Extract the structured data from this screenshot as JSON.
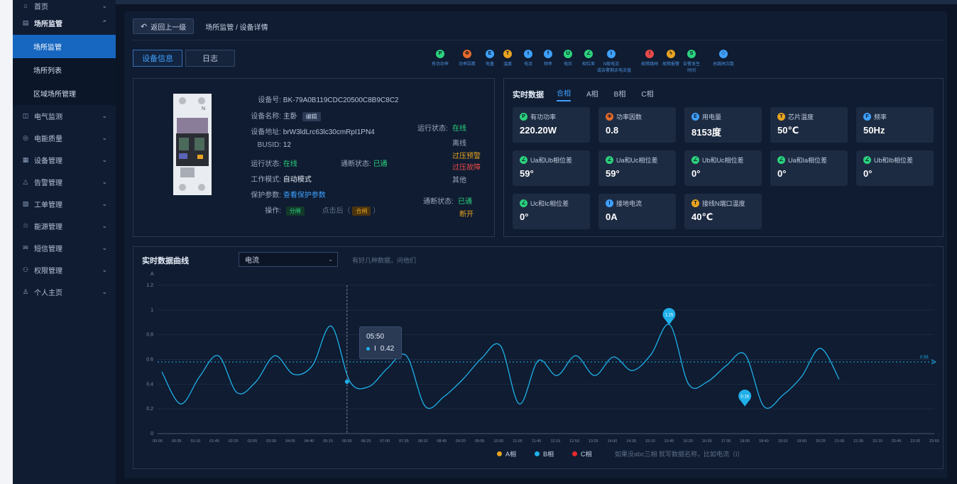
{
  "sidebar": {
    "items": [
      {
        "label": "首页",
        "icon": "home-icon",
        "glyph": "⌂"
      },
      {
        "label": "场所监管",
        "icon": "building-icon",
        "glyph": "▤",
        "expanded": true,
        "children": [
          "场所监管",
          "场所列表",
          "区域场所管理"
        ]
      },
      {
        "label": "电气监测",
        "icon": "monitor-icon",
        "glyph": "◫"
      },
      {
        "label": "电能质量",
        "icon": "quality-icon",
        "glyph": "◎"
      },
      {
        "label": "设备管理",
        "icon": "device-icon",
        "glyph": "▦"
      },
      {
        "label": "告警管理",
        "icon": "alarm-icon",
        "glyph": "△"
      },
      {
        "label": "工单管理",
        "icon": "ticket-icon",
        "glyph": "▧"
      },
      {
        "label": "能源管理",
        "icon": "energy-icon",
        "glyph": "♲"
      },
      {
        "label": "短信管理",
        "icon": "sms-icon",
        "glyph": "✉"
      },
      {
        "label": "权限管理",
        "icon": "permission-icon",
        "glyph": "⚇"
      },
      {
        "label": "个人主页",
        "icon": "user-icon",
        "glyph": "♙"
      }
    ]
  },
  "header": {
    "back_label": "返回上一级",
    "back_icon": "↶",
    "breadcrumb": "场所监管 /  设备详情"
  },
  "tabs": [
    "设备信息",
    "日志"
  ],
  "legend_icons": [
    {
      "label": "有功功率",
      "glyph": "P",
      "color": "#2bd27d"
    },
    {
      "label": "功率因素",
      "glyph": "Φ",
      "color": "#e86b2b"
    },
    {
      "label": "电量",
      "glyph": "E",
      "color": "#3fa0ff"
    },
    {
      "label": "温度",
      "glyph": "T",
      "color": "#e8a320"
    },
    {
      "label": "电流",
      "glyph": "I",
      "color": "#3fa0ff"
    },
    {
      "label": "频率",
      "glyph": "f",
      "color": "#3fa0ff"
    },
    {
      "label": "电压",
      "glyph": "U",
      "color": "#2bd27d"
    },
    {
      "label": "相位差",
      "glyph": "∠",
      "color": "#2bd27d"
    },
    {
      "label": "N极电流",
      "label2": "或告警剩余电流值",
      "glyph": "I",
      "color": "#3fa0ff"
    },
    {
      "label": "故障跳闸",
      "glyph": "!",
      "color": "#e84a4a"
    },
    {
      "label": "故障报警",
      "glyph": "ϟ",
      "color": "#e8a320"
    },
    {
      "label": "告警发生",
      "label2": "时间",
      "glyph": "S",
      "color": "#2bd27d"
    },
    {
      "label": "总跳闸次数",
      "glyph": "⁘",
      "color": "#3fa0ff"
    }
  ],
  "device": {
    "id_label": "设备号:",
    "id_value": "BK-79A0B119CDC20500C8B9C8C2",
    "name_label": "设备名称:",
    "name_value": "主卧",
    "edit_label": "编辑",
    "addr_label": "设备地址:",
    "addr_value": "brW3ldLrc63lc30cmRpI1PN4",
    "busid_label": "BUSID:",
    "busid_value": "12",
    "run_label": "运行状态:",
    "run_value": "在线",
    "conn_label": "通断状态:",
    "conn_value": "已通",
    "mode_label": "工作模式:",
    "mode_value": "自动模式",
    "protect_label": "保护参数:",
    "protect_value": "查看保护参数",
    "op_label": "操作:",
    "op_off": "分闸",
    "op_click": "点击后（",
    "op_on": "合闸",
    "op_close": "）",
    "legend_run_label": "运行状态:",
    "legend_run_states": [
      "在线",
      "离线",
      "过压预警",
      "过压故障",
      "其他"
    ],
    "legend_conn_label": "通断状态:",
    "legend_conn_states": [
      "已通",
      "断开"
    ],
    "breaker_label": "N"
  },
  "realtime": {
    "title": "实时数据",
    "tabs": [
      "合相",
      "A相",
      "B相",
      "C相"
    ],
    "metrics": [
      {
        "label": "有功功率",
        "glyph": "P",
        "color": "#2bd27d",
        "value": "220.20W"
      },
      {
        "label": "功率因数",
        "glyph": "Φ",
        "color": "#e86b2b",
        "value": "0.8"
      },
      {
        "label": "用电量",
        "glyph": "E",
        "color": "#3fa0ff",
        "value": "8153度"
      },
      {
        "label": "芯片温度",
        "glyph": "T",
        "color": "#e8a320",
        "value": "50℃"
      },
      {
        "label": "频率",
        "glyph": "F",
        "color": "#3fa0ff",
        "value": "50Hz"
      },
      {
        "label": "Ua和Ub相位差",
        "glyph": "∠",
        "color": "#2bd27d",
        "value": "59°"
      },
      {
        "label": "Ua和Uc相位差",
        "glyph": "∠",
        "color": "#2bd27d",
        "value": "59°"
      },
      {
        "label": "Ub和Uc相位差",
        "glyph": "∠",
        "color": "#2bd27d",
        "value": "0°"
      },
      {
        "label": "Ua和Ia相位差",
        "glyph": "∠",
        "color": "#2bd27d",
        "value": "0°"
      },
      {
        "label": "Ub和Ib相位差",
        "glyph": "∠",
        "color": "#2bd27d",
        "value": "0°"
      },
      {
        "label": "Uc和Ic相位差",
        "glyph": "∠",
        "color": "#2bd27d",
        "value": "0°"
      },
      {
        "label": "接地电流",
        "glyph": "I",
        "color": "#3fa0ff",
        "value": "0A"
      },
      {
        "label": "接线N端口温度",
        "glyph": "T",
        "color": "#e8a320",
        "value": "40℃"
      }
    ]
  },
  "curve": {
    "title": "实时数据曲线",
    "select_value": "电流",
    "hint": "有好几种数据，问他们",
    "legend": [
      {
        "label": "A相",
        "color": "#e8a320"
      },
      {
        "label": "B相",
        "color": "#1fb0ea"
      },
      {
        "label": "C相",
        "color": "#e8282b"
      }
    ],
    "legend_note": "如果没abc三相 就写数据名称，比如电流（I）",
    "tooltip_time": "05:50",
    "tooltip_series": "I",
    "tooltip_value": "0.42"
  },
  "chart_data": {
    "type": "line",
    "ylabel": "A",
    "ylim": [
      0,
      1.2
    ],
    "yticks": [
      0,
      0.2,
      0.4,
      0.6,
      0.8,
      1,
      1.2
    ],
    "x": [
      "00:00",
      "00:35",
      "01:10",
      "01:45",
      "02:20",
      "02:55",
      "03:30",
      "04:05",
      "04:40",
      "05:15",
      "05:50",
      "06:25",
      "07:00",
      "07:35",
      "08:10",
      "08:45",
      "09:20",
      "09:55",
      "10:30",
      "11:05",
      "11:40",
      "12:15",
      "12:50",
      "13:25",
      "14:00",
      "14:35",
      "15:10",
      "15:45",
      "16:20",
      "16:55",
      "17:30",
      "18:05",
      "18:40",
      "19:15",
      "19:50",
      "20:25",
      "21:00",
      "21:35",
      "22:10",
      "22:45",
      "23:20",
      "23:55"
    ],
    "series": [
      {
        "name": "B相",
        "color": "#1fb0ea",
        "values": [
          0.5,
          0.24,
          0.46,
          0.63,
          0.33,
          0.42,
          0.63,
          0.48,
          0.55,
          0.87,
          0.42,
          0.38,
          0.53,
          0.63,
          0.22,
          0.3,
          0.44,
          0.61,
          0.71,
          0.24,
          0.59,
          0.47,
          0.63,
          0.47,
          0.62,
          0.51,
          0.64,
          0.88,
          0.4,
          0.42,
          0.55,
          0.64,
          0.22,
          0.31,
          0.46,
          0.69,
          0.44
        ]
      }
    ],
    "average_line": 0.58,
    "average_label": "0.58",
    "max_marker": {
      "x": "15:45",
      "value": 0.88,
      "label": "1.15"
    },
    "min_marker": {
      "x": "18:05",
      "value": 0.22,
      "label": "0.16"
    },
    "cursor": {
      "x": "05:50",
      "value": 0.42
    }
  }
}
